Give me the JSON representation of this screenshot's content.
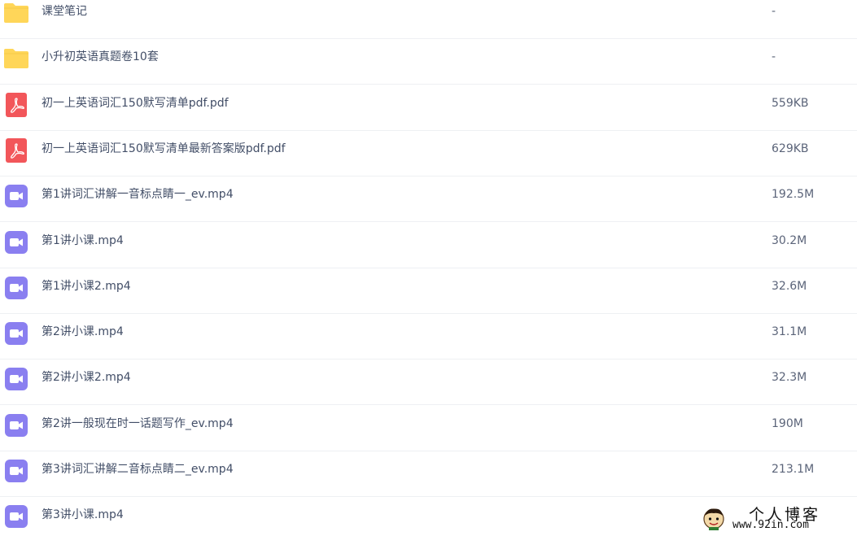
{
  "colors": {
    "folder": "#ffd659",
    "pdf": "#f2565a",
    "video": "#8a7ff0",
    "divider": "#eef0f3",
    "name_text": "#424e67",
    "size_text": "#5b6479"
  },
  "files": [
    {
      "name": "课堂笔记",
      "size": "-",
      "type": "folder",
      "icon": "folder-icon"
    },
    {
      "name": "小升初英语真题卷10套",
      "size": "-",
      "type": "folder",
      "icon": "folder-icon"
    },
    {
      "name": "初一上英语词汇150默写清单pdf.pdf",
      "size": "559KB",
      "type": "pdf",
      "icon": "pdf-icon"
    },
    {
      "name": "初一上英语词汇150默写清单最新答案版pdf.pdf",
      "size": "629KB",
      "type": "pdf",
      "icon": "pdf-icon"
    },
    {
      "name": "第1讲词汇讲解一音标点睛一_ev.mp4",
      "size": "192.5M",
      "type": "video",
      "icon": "video-icon"
    },
    {
      "name": "第1讲小课.mp4",
      "size": "30.2M",
      "type": "video",
      "icon": "video-icon"
    },
    {
      "name": "第1讲小课2.mp4",
      "size": "32.6M",
      "type": "video",
      "icon": "video-icon"
    },
    {
      "name": "第2讲小课.mp4",
      "size": "31.1M",
      "type": "video",
      "icon": "video-icon"
    },
    {
      "name": "第2讲小课2.mp4",
      "size": "32.3M",
      "type": "video",
      "icon": "video-icon"
    },
    {
      "name": "第2讲一般现在时一话题写作_ev.mp4",
      "size": "190M",
      "type": "video",
      "icon": "video-icon"
    },
    {
      "name": "第3讲词汇讲解二音标点睛二_ev.mp4",
      "size": "213.1M",
      "type": "video",
      "icon": "video-icon"
    },
    {
      "name": "第3讲小课.mp4",
      "size": "",
      "type": "video",
      "icon": "video-icon"
    }
  ],
  "watermark": {
    "title": "个人博客",
    "url": "www.92in.com"
  }
}
